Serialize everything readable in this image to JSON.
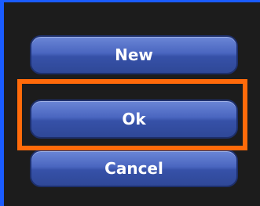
{
  "buttons": {
    "new_label": "New",
    "ok_label": "Ok",
    "cancel_label": "Cancel"
  },
  "colors": {
    "highlight": "#ff6a0a",
    "frame": "#1a5cff",
    "button": "#4a66c0",
    "background": "#1c1c1c"
  }
}
